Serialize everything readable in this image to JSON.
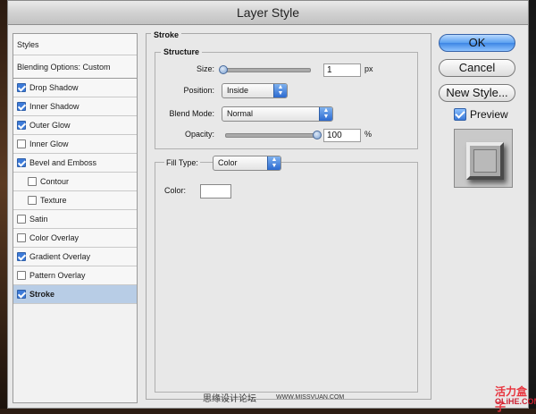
{
  "window": {
    "title": "Layer Style"
  },
  "styles_list": {
    "header": "Styles",
    "blending": "Blending Options: Custom",
    "items": [
      {
        "label": "Drop Shadow",
        "checked": true,
        "indent": false
      },
      {
        "label": "Inner Shadow",
        "checked": true,
        "indent": false
      },
      {
        "label": "Outer Glow",
        "checked": true,
        "indent": false
      },
      {
        "label": "Inner Glow",
        "checked": false,
        "indent": false
      },
      {
        "label": "Bevel and Emboss",
        "checked": true,
        "indent": false
      },
      {
        "label": "Contour",
        "checked": false,
        "indent": true
      },
      {
        "label": "Texture",
        "checked": false,
        "indent": true
      },
      {
        "label": "Satin",
        "checked": false,
        "indent": false
      },
      {
        "label": "Color Overlay",
        "checked": false,
        "indent": false
      },
      {
        "label": "Gradient Overlay",
        "checked": true,
        "indent": false
      },
      {
        "label": "Pattern Overlay",
        "checked": false,
        "indent": false
      },
      {
        "label": "Stroke",
        "checked": true,
        "indent": false,
        "selected": true
      }
    ]
  },
  "stroke": {
    "title": "Stroke",
    "structure": {
      "title": "Structure",
      "size_label": "Size:",
      "size_value": "1",
      "size_unit": "px",
      "position_label": "Position:",
      "position_value": "Inside",
      "blend_mode_label": "Blend Mode:",
      "blend_mode_value": "Normal",
      "opacity_label": "Opacity:",
      "opacity_value": "100",
      "opacity_unit": "%"
    },
    "fill": {
      "type_label": "Fill Type:",
      "type_value": "Color",
      "color_label": "Color:",
      "color_value": "#ffffff"
    }
  },
  "buttons": {
    "ok": "OK",
    "cancel": "Cancel",
    "new_style": "New Style..."
  },
  "preview": {
    "label": "Preview",
    "checked": true
  },
  "watermark": {
    "cn": "思缘设计论坛",
    "en": "WWW.MISSVUAN.COM",
    "logo_cn": "活力盒子",
    "logo_en": "OLiHE.COM"
  }
}
